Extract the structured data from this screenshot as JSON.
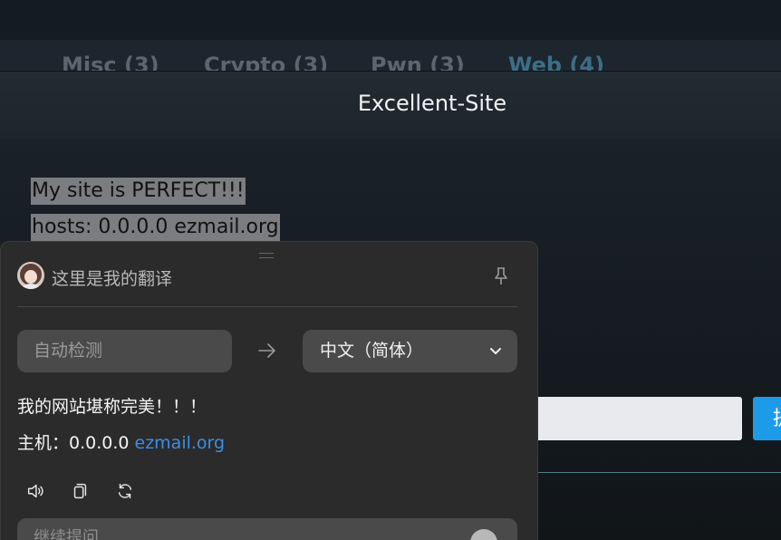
{
  "header": {
    "tabs": [
      {
        "label": ")"
      },
      {
        "label": "Misc (3)"
      },
      {
        "label": "Crypto (3)"
      },
      {
        "label": "Pwn (3)"
      },
      {
        "label": "Web (4)",
        "active": true
      }
    ]
  },
  "modal": {
    "title": "Excellent-Site",
    "lines": [
      "My site is PERFECT!!!",
      "hosts: 0.0.0.0 ezmail.org"
    ],
    "submit_label": "提"
  },
  "translator": {
    "title": "这里是我的翻译",
    "source_lang": "自动检测",
    "target_lang": "中文（简体）",
    "result_line1": "我的网站堪称完美！！！",
    "result_line2_prefix": "主机：0.0.0.0 ",
    "result_line2_link": "ezmail.org",
    "followup_placeholder": "继续提问"
  },
  "colors": {
    "accent_link": "#3b8fe6",
    "submit_blue": "#1e9be8",
    "active_tab": "#3c6f86"
  }
}
